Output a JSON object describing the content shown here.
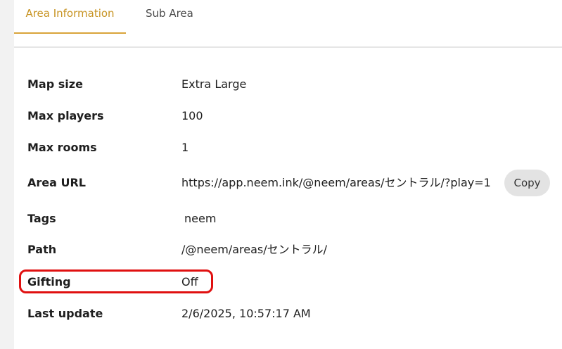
{
  "tabs": [
    {
      "label": "Area Information",
      "active": true
    },
    {
      "label": "Sub Area",
      "active": false
    }
  ],
  "details": [
    {
      "label": "Map size",
      "value": "Extra Large"
    },
    {
      "label": "Max players",
      "value": "100"
    },
    {
      "label": "Max rooms",
      "value": "1"
    },
    {
      "label": "Area URL",
      "value": "https://app.neem.ink/@neem/areas/セントラル/?play=1"
    },
    {
      "label": "Tags",
      "value": "neem"
    },
    {
      "label": "Path",
      "value": "/@neem/areas/セントラル/"
    },
    {
      "label": "Gifting",
      "value": "Off"
    },
    {
      "label": "Last update",
      "value": "2/6/2025, 10:57:17 AM"
    }
  ],
  "copy_button": {
    "label": "Copy"
  },
  "colors": {
    "active_tab": "#c79322",
    "highlight": "#e01010",
    "copy_button_bg": "#e3e3e3"
  }
}
